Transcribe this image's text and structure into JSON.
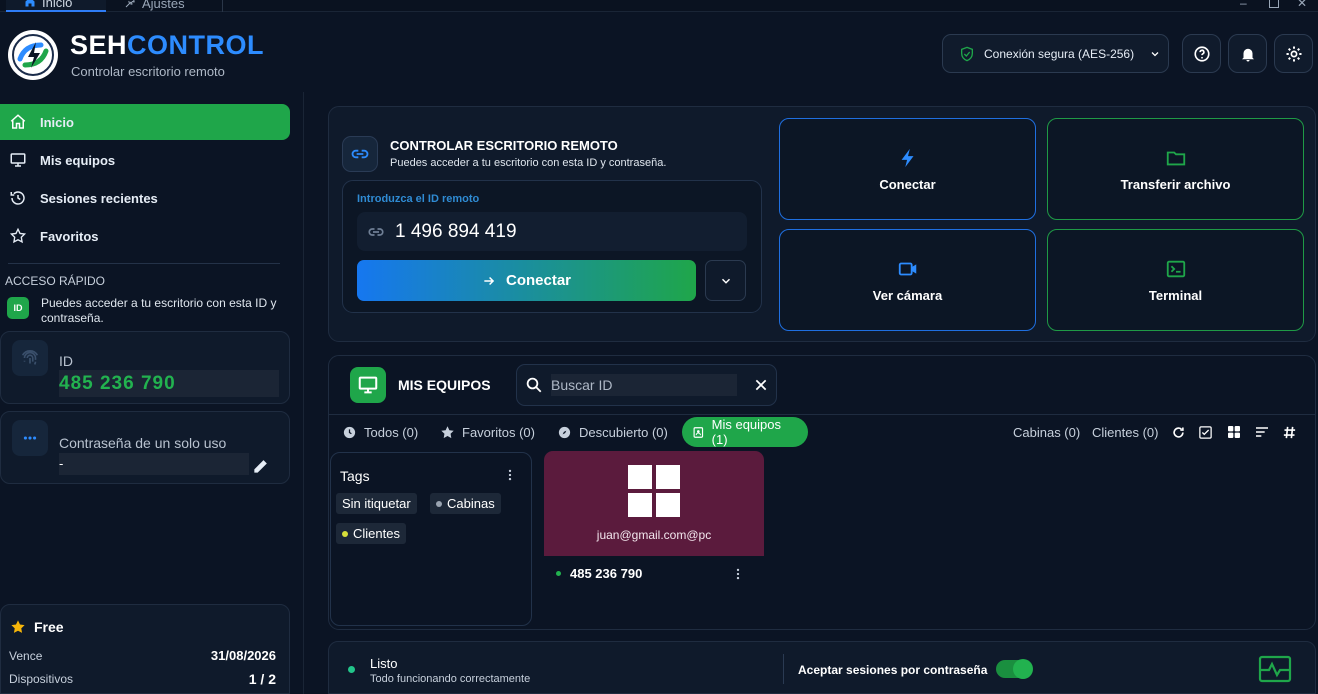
{
  "window": {
    "tabs": [
      {
        "label": "Inicio"
      },
      {
        "label": "Ajustes"
      }
    ]
  },
  "header": {
    "brand_part1": "SEH",
    "brand_part2": "CONTROL",
    "subtitle": "Controlar escritorio remoto",
    "security_label": "Conexión segura (AES-256)"
  },
  "sidebar": {
    "items": [
      {
        "label": "Inicio",
        "icon": "home-icon",
        "active": true
      },
      {
        "label": "Mis equipos",
        "icon": "monitor-icon"
      },
      {
        "label": "Sesiones recientes",
        "icon": "history-icon"
      },
      {
        "label": "Favoritos",
        "icon": "star-icon"
      }
    ],
    "quick_access": {
      "title": "ACCESO RÁPIDO",
      "badge": "ID",
      "text": "Puedes acceder a tu escritorio con esta ID y contraseña.",
      "id_label": "ID",
      "id_value": "485 236 790",
      "password_label": "Contraseña de un solo uso",
      "password_value": "-"
    },
    "plan": {
      "name": "Free",
      "expires_label": "Vence",
      "expires_value": "31/08/2026",
      "devices_label": "Dispositivos",
      "devices_value": "1 / 2"
    }
  },
  "remote": {
    "title": "CONTROLAR ESCRITORIO REMOTO",
    "subtitle": "Puedes acceder a tu escritorio con esta ID y contraseña.",
    "input_label": "Introduzca el ID remoto",
    "input_value": "1 496 894 419",
    "connect_label": "Conectar"
  },
  "quick_actions": [
    {
      "label": "Conectar",
      "icon": "lightning-icon"
    },
    {
      "label": "Transferir archivo",
      "icon": "folder-icon"
    },
    {
      "label": "Ver cámara",
      "icon": "camera-icon"
    },
    {
      "label": "Terminal",
      "icon": "terminal-icon"
    }
  ],
  "devices": {
    "title": "MIS EQUIPOS",
    "search_placeholder": "Buscar ID",
    "filters": [
      {
        "label": "Todos (0)",
        "icon": "clock-icon"
      },
      {
        "label": "Favoritos (0)",
        "icon": "star-icon"
      },
      {
        "label": "Descubierto (0)",
        "icon": "compass-icon"
      },
      {
        "label": "Mis equipos (1)",
        "icon": "contact-icon",
        "active": true
      }
    ],
    "right_filters": [
      {
        "label": "Cabinas (0)"
      },
      {
        "label": "Clientes (0)"
      }
    ],
    "tags_title": "Tags",
    "tags": [
      {
        "label": "Sin itiquetar"
      },
      {
        "label": "Cabinas",
        "color": "#9aa4b1"
      },
      {
        "label": "Clientes",
        "color": "#d7df3a"
      }
    ],
    "items": [
      {
        "account": "juan@gmail.com@pc",
        "id": "485 236 790",
        "os": "windows-icon",
        "tile_color": "#5b1b3d",
        "online": true
      }
    ]
  },
  "status": {
    "title": "Listo",
    "subtitle": "Todo funcionando correctamente",
    "toggle_label": "Aceptar sesiones por contraseña",
    "toggle_on": true
  },
  "colors": {
    "accent_green": "#1fa64a",
    "accent_blue": "#2d8cff",
    "background": "#0b1424"
  }
}
